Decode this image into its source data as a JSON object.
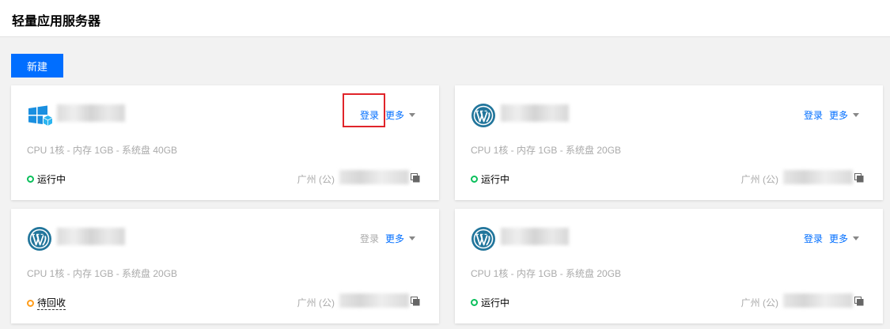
{
  "header": {
    "title": "轻量应用服务器"
  },
  "toolbar": {
    "new_label": "新建"
  },
  "colors": {
    "accent": "#006eff",
    "running": "#0abf5b",
    "pending": "#ff9c19",
    "highlight": "#e0242a"
  },
  "cards": [
    {
      "icon": "windows-icon",
      "login_label": "登录",
      "login_enabled": true,
      "more_label": "更多",
      "specs": "CPU 1核 - 内存 1GB - 系统盘 40GB",
      "status": "运行中",
      "status_type": "running",
      "region": "广州 (公)"
    },
    {
      "icon": "wordpress-icon",
      "login_label": "登录",
      "login_enabled": true,
      "more_label": "更多",
      "specs": "CPU 1核 - 内存 1GB - 系统盘 20GB",
      "status": "运行中",
      "status_type": "running",
      "region": "广州 (公)"
    },
    {
      "icon": "wordpress-icon",
      "login_label": "登录",
      "login_enabled": false,
      "more_label": "更多",
      "specs": "CPU 1核 - 内存 1GB - 系统盘 20GB",
      "status": "待回收",
      "status_type": "pending",
      "region": "广州 (公)"
    },
    {
      "icon": "wordpress-icon",
      "login_label": "登录",
      "login_enabled": true,
      "more_label": "更多",
      "specs": "CPU 1核 - 内存 1GB - 系统盘 20GB",
      "status": "运行中",
      "status_type": "running",
      "region": "广州 (公)"
    }
  ]
}
